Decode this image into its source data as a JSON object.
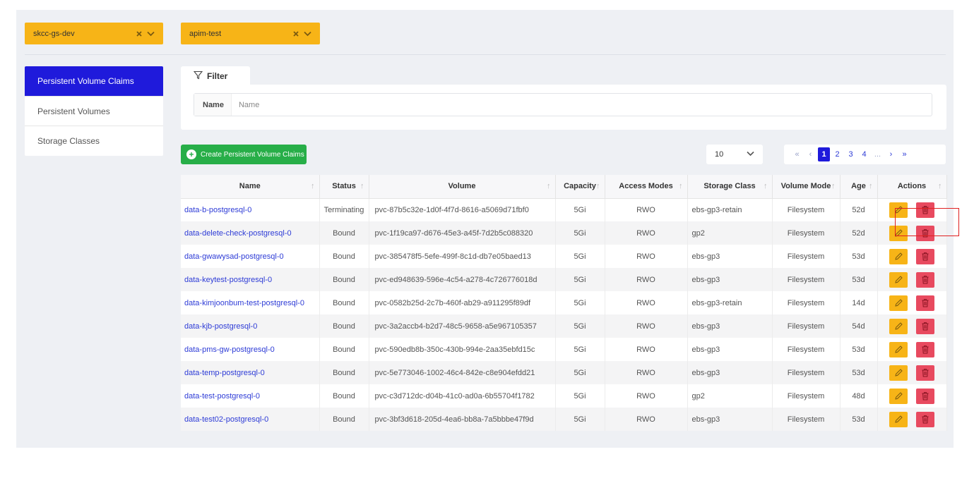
{
  "selectors": {
    "cluster": "skcc-gs-dev",
    "namespace": "apim-test"
  },
  "sidebar": {
    "items": [
      {
        "label": "Persistent Volume Claims",
        "active": true
      },
      {
        "label": "Persistent Volumes",
        "active": false
      },
      {
        "label": "Storage Classes",
        "active": false
      }
    ]
  },
  "filter": {
    "title": "Filter",
    "field_label": "Name",
    "placeholder": "Name"
  },
  "toolbar": {
    "create_label": "Create Persistent Volume Claims",
    "page_size": "10"
  },
  "pagination": {
    "first": "«",
    "prev": "‹",
    "pages": [
      "1",
      "2",
      "3",
      "4"
    ],
    "current": "1",
    "ellipsis": "...",
    "next": "›",
    "last": "»"
  },
  "table": {
    "columns": [
      "Name",
      "Status",
      "Volume",
      "Capacity",
      "Access Modes",
      "Storage Class",
      "Volume Mode",
      "Age",
      "Actions"
    ],
    "rows": [
      {
        "name": "data-b-postgresql-0",
        "status": "Terminating",
        "volume": "pvc-87b5c32e-1d0f-4f7d-8616-a5069d71fbf0",
        "capacity": "5Gi",
        "access": "RWO",
        "storage_class": "ebs-gp3-retain",
        "mode": "Filesystem",
        "age": "52d"
      },
      {
        "name": "data-delete-check-postgresql-0",
        "status": "Bound",
        "volume": "pvc-1f19ca97-d676-45e3-a45f-7d2b5c088320",
        "capacity": "5Gi",
        "access": "RWO",
        "storage_class": "gp2",
        "mode": "Filesystem",
        "age": "52d"
      },
      {
        "name": "data-gwawysad-postgresql-0",
        "status": "Bound",
        "volume": "pvc-385478f5-5efe-499f-8c1d-db7e05baed13",
        "capacity": "5Gi",
        "access": "RWO",
        "storage_class": "ebs-gp3",
        "mode": "Filesystem",
        "age": "53d"
      },
      {
        "name": "data-keytest-postgresql-0",
        "status": "Bound",
        "volume": "pvc-ed948639-596e-4c54-a278-4c726776018d",
        "capacity": "5Gi",
        "access": "RWO",
        "storage_class": "ebs-gp3",
        "mode": "Filesystem",
        "age": "53d"
      },
      {
        "name": "data-kimjoonbum-test-postgresql-0",
        "status": "Bound",
        "volume": "pvc-0582b25d-2c7b-460f-ab29-a911295f89df",
        "capacity": "5Gi",
        "access": "RWO",
        "storage_class": "ebs-gp3-retain",
        "mode": "Filesystem",
        "age": "14d"
      },
      {
        "name": "data-kjb-postgresql-0",
        "status": "Bound",
        "volume": "pvc-3a2accb4-b2d7-48c5-9658-a5e967105357",
        "capacity": "5Gi",
        "access": "RWO",
        "storage_class": "ebs-gp3",
        "mode": "Filesystem",
        "age": "54d"
      },
      {
        "name": "data-pms-gw-postgresql-0",
        "status": "Bound",
        "volume": "pvc-590edb8b-350c-430b-994e-2aa35ebfd15c",
        "capacity": "5Gi",
        "access": "RWO",
        "storage_class": "ebs-gp3",
        "mode": "Filesystem",
        "age": "53d"
      },
      {
        "name": "data-temp-postgresql-0",
        "status": "Bound",
        "volume": "pvc-5e773046-1002-46c4-842e-c8e904efdd21",
        "capacity": "5Gi",
        "access": "RWO",
        "storage_class": "ebs-gp3",
        "mode": "Filesystem",
        "age": "53d"
      },
      {
        "name": "data-test-postgresql-0",
        "status": "Bound",
        "volume": "pvc-c3d712dc-d04b-41c0-ad0a-6b55704f1782",
        "capacity": "5Gi",
        "access": "RWO",
        "storage_class": "gp2",
        "mode": "Filesystem",
        "age": "48d"
      },
      {
        "name": "data-test02-postgresql-0",
        "status": "Bound",
        "volume": "pvc-3bf3d618-205d-4ea6-bb8a-7a5bbbe47f9d",
        "capacity": "5Gi",
        "access": "RWO",
        "storage_class": "ebs-gp3",
        "mode": "Filesystem",
        "age": "53d"
      }
    ]
  },
  "icons": {
    "clear": "close-icon",
    "dropdown": "chevron-down-icon",
    "filter": "filter-icon",
    "create": "plus-circle-icon",
    "edit": "pencil-icon",
    "delete": "trash-icon",
    "sort": "sort-arrow-icon"
  },
  "colors": {
    "accent": "#1f1adb",
    "warning": "#f7b417",
    "danger": "#e84a5f",
    "success": "#27ae48",
    "link": "#2d3bd6"
  }
}
